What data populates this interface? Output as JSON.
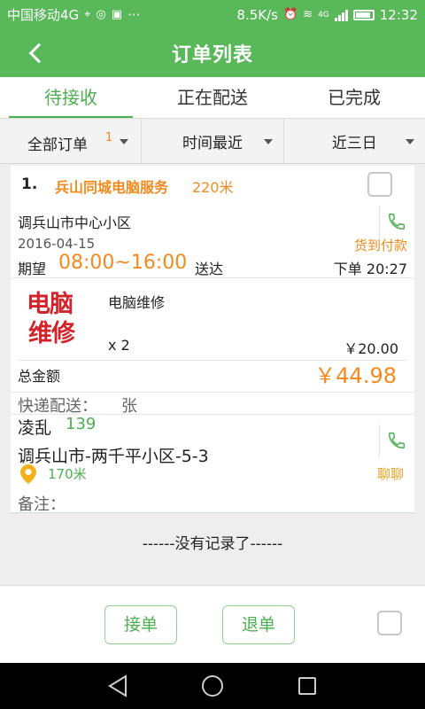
{
  "status_bar": {
    "carrier": "中国移动4G",
    "icons": [
      "location-icon",
      "wechat-icon",
      "image-icon",
      "more-icon"
    ],
    "more": "···",
    "speed": "8.5K/s",
    "network": "4G",
    "time": "12:32"
  },
  "header": {
    "title": "订单列表"
  },
  "tabs": [
    {
      "label": "待接收",
      "active": true
    },
    {
      "label": "正在配送",
      "active": false
    },
    {
      "label": "已完成",
      "active": false
    }
  ],
  "filters": {
    "all": "全部订单",
    "all_count": "1",
    "time": "时间最近",
    "range": "近三日"
  },
  "order": {
    "index": "1.",
    "shop": "兵山同城电脑服务",
    "distance": "220米",
    "address": "调兵山市中心小区",
    "date": "2016-04-15",
    "payment": "货到付款",
    "expect_label": "期望",
    "expect_time": "08:00~16:00",
    "deliver_label": "送达",
    "order_time": "下单 20:27",
    "product": {
      "logo_line1": "电脑",
      "logo_line2": "维修",
      "name": "电脑维修",
      "qty": "x 2",
      "price": "￥20.00"
    },
    "total_label": "总金额",
    "total": "￥44.98",
    "express_label": "快递配送：",
    "express_name": "张",
    "customer": {
      "name": "凌乱",
      "phone": "139",
      "address": "调兵山市-两千平小区-5-3",
      "distance": "170米",
      "chat": "聊聊"
    },
    "remark_label": "备注："
  },
  "list_end": "------没有记录了------",
  "actions": {
    "accept": "接单",
    "return": "退单"
  },
  "colors": {
    "brand": "#58b85a",
    "accent": "#f28a1e",
    "green_text": "#4caf50",
    "chat": "#e7a326"
  }
}
